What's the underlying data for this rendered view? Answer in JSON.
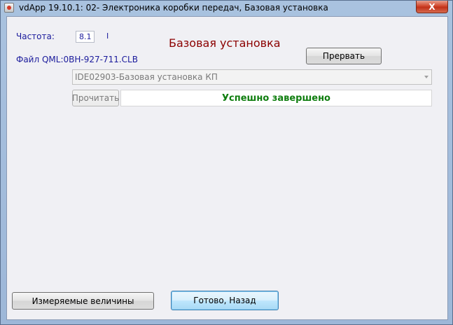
{
  "window": {
    "title": "vdApp 19.10.1: 02- Электроника коробки передач,  Базовая установка",
    "close_label": "X"
  },
  "header": {
    "frequency_label": "Частота:",
    "frequency_value": "8.1",
    "frequency_marker": "I",
    "file_label": "Файл QML:0BH-927-711.CLB",
    "page_title": "Базовая установка",
    "abort_label": "Прервать"
  },
  "procedure": {
    "selected": "IDE02903-Базовая установка КП",
    "read_label": "Прочитать",
    "status_text": "Успешно завершено"
  },
  "footer": {
    "measured_label": "Измеряемые величины",
    "done_label": "Готово, Назад"
  },
  "colors": {
    "title_accent": "#8b0000",
    "status_success": "#0e7d0e",
    "label_blue": "#1b1b9c"
  }
}
